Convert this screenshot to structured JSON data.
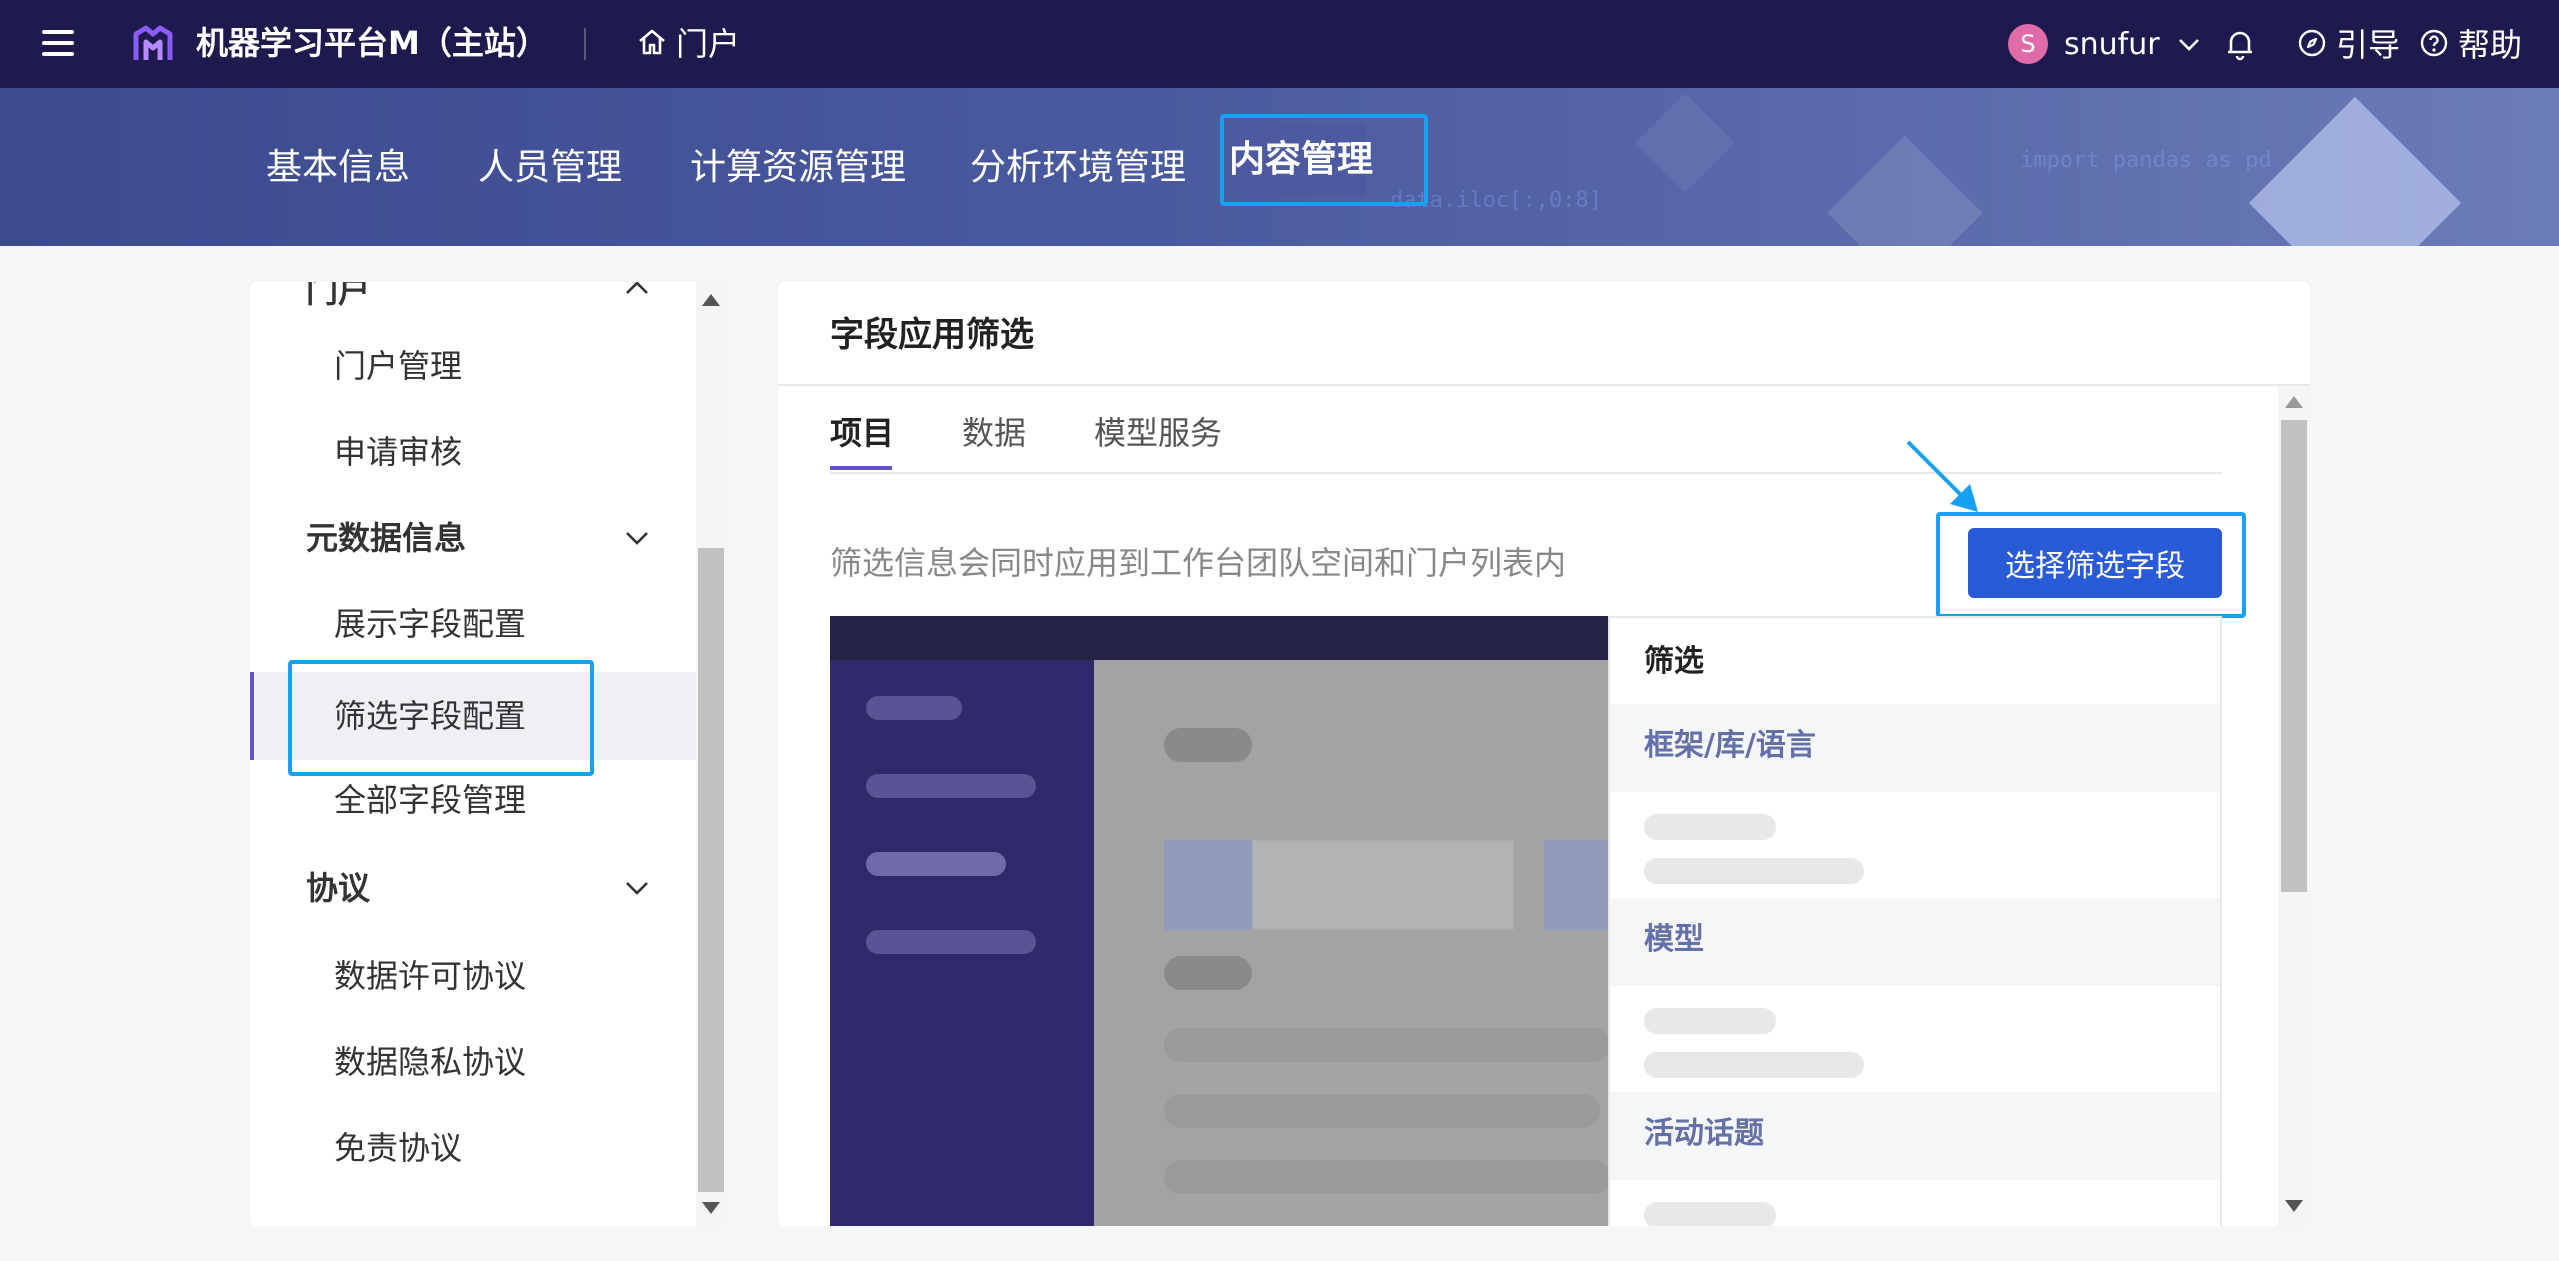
{
  "topbar": {
    "app_title": "机器学习平台M（主站）",
    "portal_label": "门户",
    "user_initial": "S",
    "username": "snufur",
    "guide_label": "引导",
    "help_label": "帮助"
  },
  "banner": {
    "tabs": [
      "基本信息",
      "人员管理",
      "计算资源管理",
      "分析环境管理",
      "内容管理"
    ],
    "active_tab": "内容管理",
    "deco_code_1": "import pandas as pd",
    "deco_code_2": "data.iloc[:,0:8]"
  },
  "sidebar": {
    "cut_group": "门户",
    "items_portal": [
      "门户管理",
      "申请审核"
    ],
    "group_metadata": "元数据信息",
    "items_metadata": [
      "展示字段配置",
      "筛选字段配置",
      "全部字段管理"
    ],
    "active_item": "筛选字段配置",
    "group_agreements": "协议",
    "items_agreements": [
      "数据许可协议",
      "数据隐私协议",
      "免责协议"
    ]
  },
  "panel": {
    "title": "字段应用筛选",
    "tabs": [
      "项目",
      "数据",
      "模型服务"
    ],
    "active_tab": "项目",
    "hint": "筛选信息会同时应用到工作台团队空间和门户列表内",
    "primary_button": "选择筛选字段"
  },
  "preview": {
    "filter_title": "筛选",
    "sections": [
      "框架/库/语言",
      "模型",
      "活动话题"
    ]
  },
  "colors": {
    "topbar_bg": "#1f1a4e",
    "accent": "#6750c9",
    "primary_button": "#2a5bd7",
    "highlight_outline": "#17a1f5"
  }
}
